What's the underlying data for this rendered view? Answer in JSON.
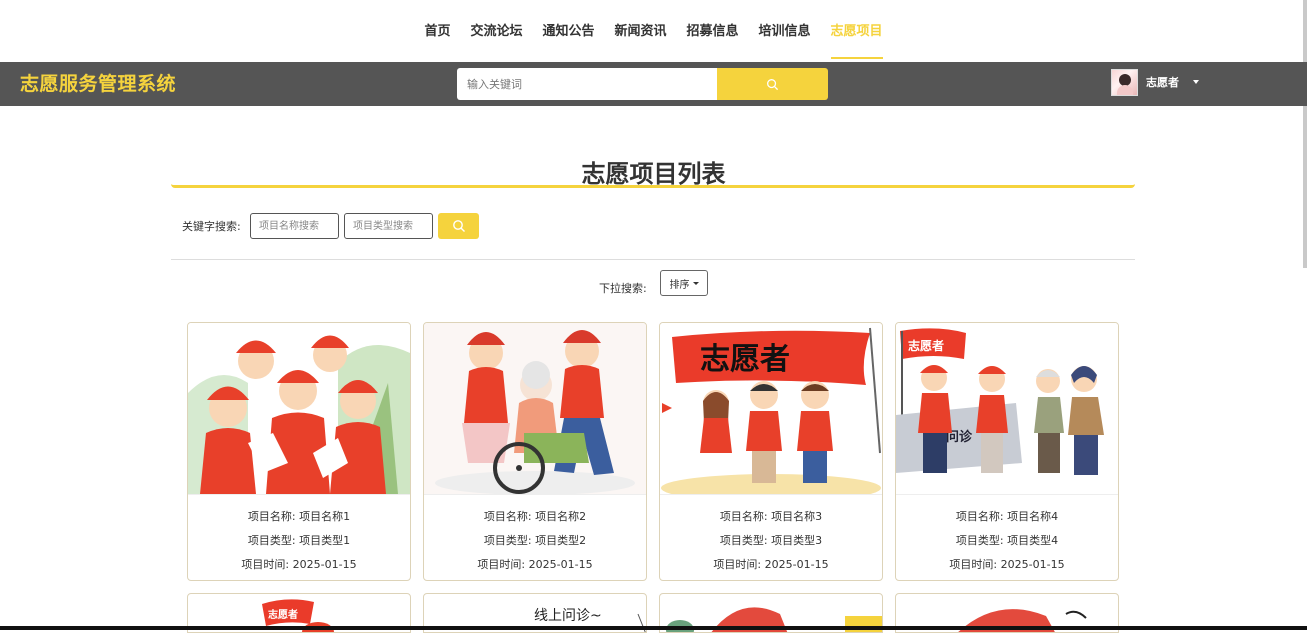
{
  "nav": {
    "items": [
      {
        "label": "首页"
      },
      {
        "label": "交流论坛"
      },
      {
        "label": "通知公告"
      },
      {
        "label": "新闻资讯"
      },
      {
        "label": "招募信息"
      },
      {
        "label": "培训信息"
      },
      {
        "label": "志愿项目"
      }
    ],
    "active_index": 6
  },
  "header": {
    "brand": "志愿服务管理系统",
    "search_placeholder": "输入关键词",
    "user_name": "志愿者"
  },
  "main": {
    "title": "志愿项目列表",
    "keyword_label": "关键字搜索:",
    "name_placeholder": "项目名称搜索",
    "type_placeholder": "项目类型搜索",
    "dropdown_label": "下拉搜索:",
    "sort_label": "排序"
  },
  "cards": [
    {
      "name_key": "项目名称:",
      "name": "项目名称1",
      "type_key": "项目类型:",
      "type": "项目类型1",
      "time_key": "项目时间:",
      "time": "2025-01-15"
    },
    {
      "name_key": "项目名称:",
      "name": "项目名称2",
      "type_key": "项目类型:",
      "type": "项目类型2",
      "time_key": "项目时间:",
      "time": "2025-01-15"
    },
    {
      "name_key": "项目名称:",
      "name": "项目名称3",
      "type_key": "项目类型:",
      "type": "项目类型3",
      "time_key": "项目时间:",
      "time": "2025-01-15"
    },
    {
      "name_key": "项目名称:",
      "name": "项目名称4",
      "type_key": "项目类型:",
      "type": "项目类型4",
      "time_key": "项目时间:",
      "time": "2025-01-15"
    }
  ],
  "image_text": {
    "flag_1": "志愿者",
    "flag_2": "志愿者",
    "badge_1": "志愿者",
    "banner_2": "线上问诊~",
    "bus_text": "问诊"
  },
  "colors": {
    "accent": "#f5d33d",
    "header_bg": "#555555",
    "vest_red": "#e8402a"
  },
  "icons": {
    "search": "search-icon",
    "caret": "caret-down-icon"
  }
}
